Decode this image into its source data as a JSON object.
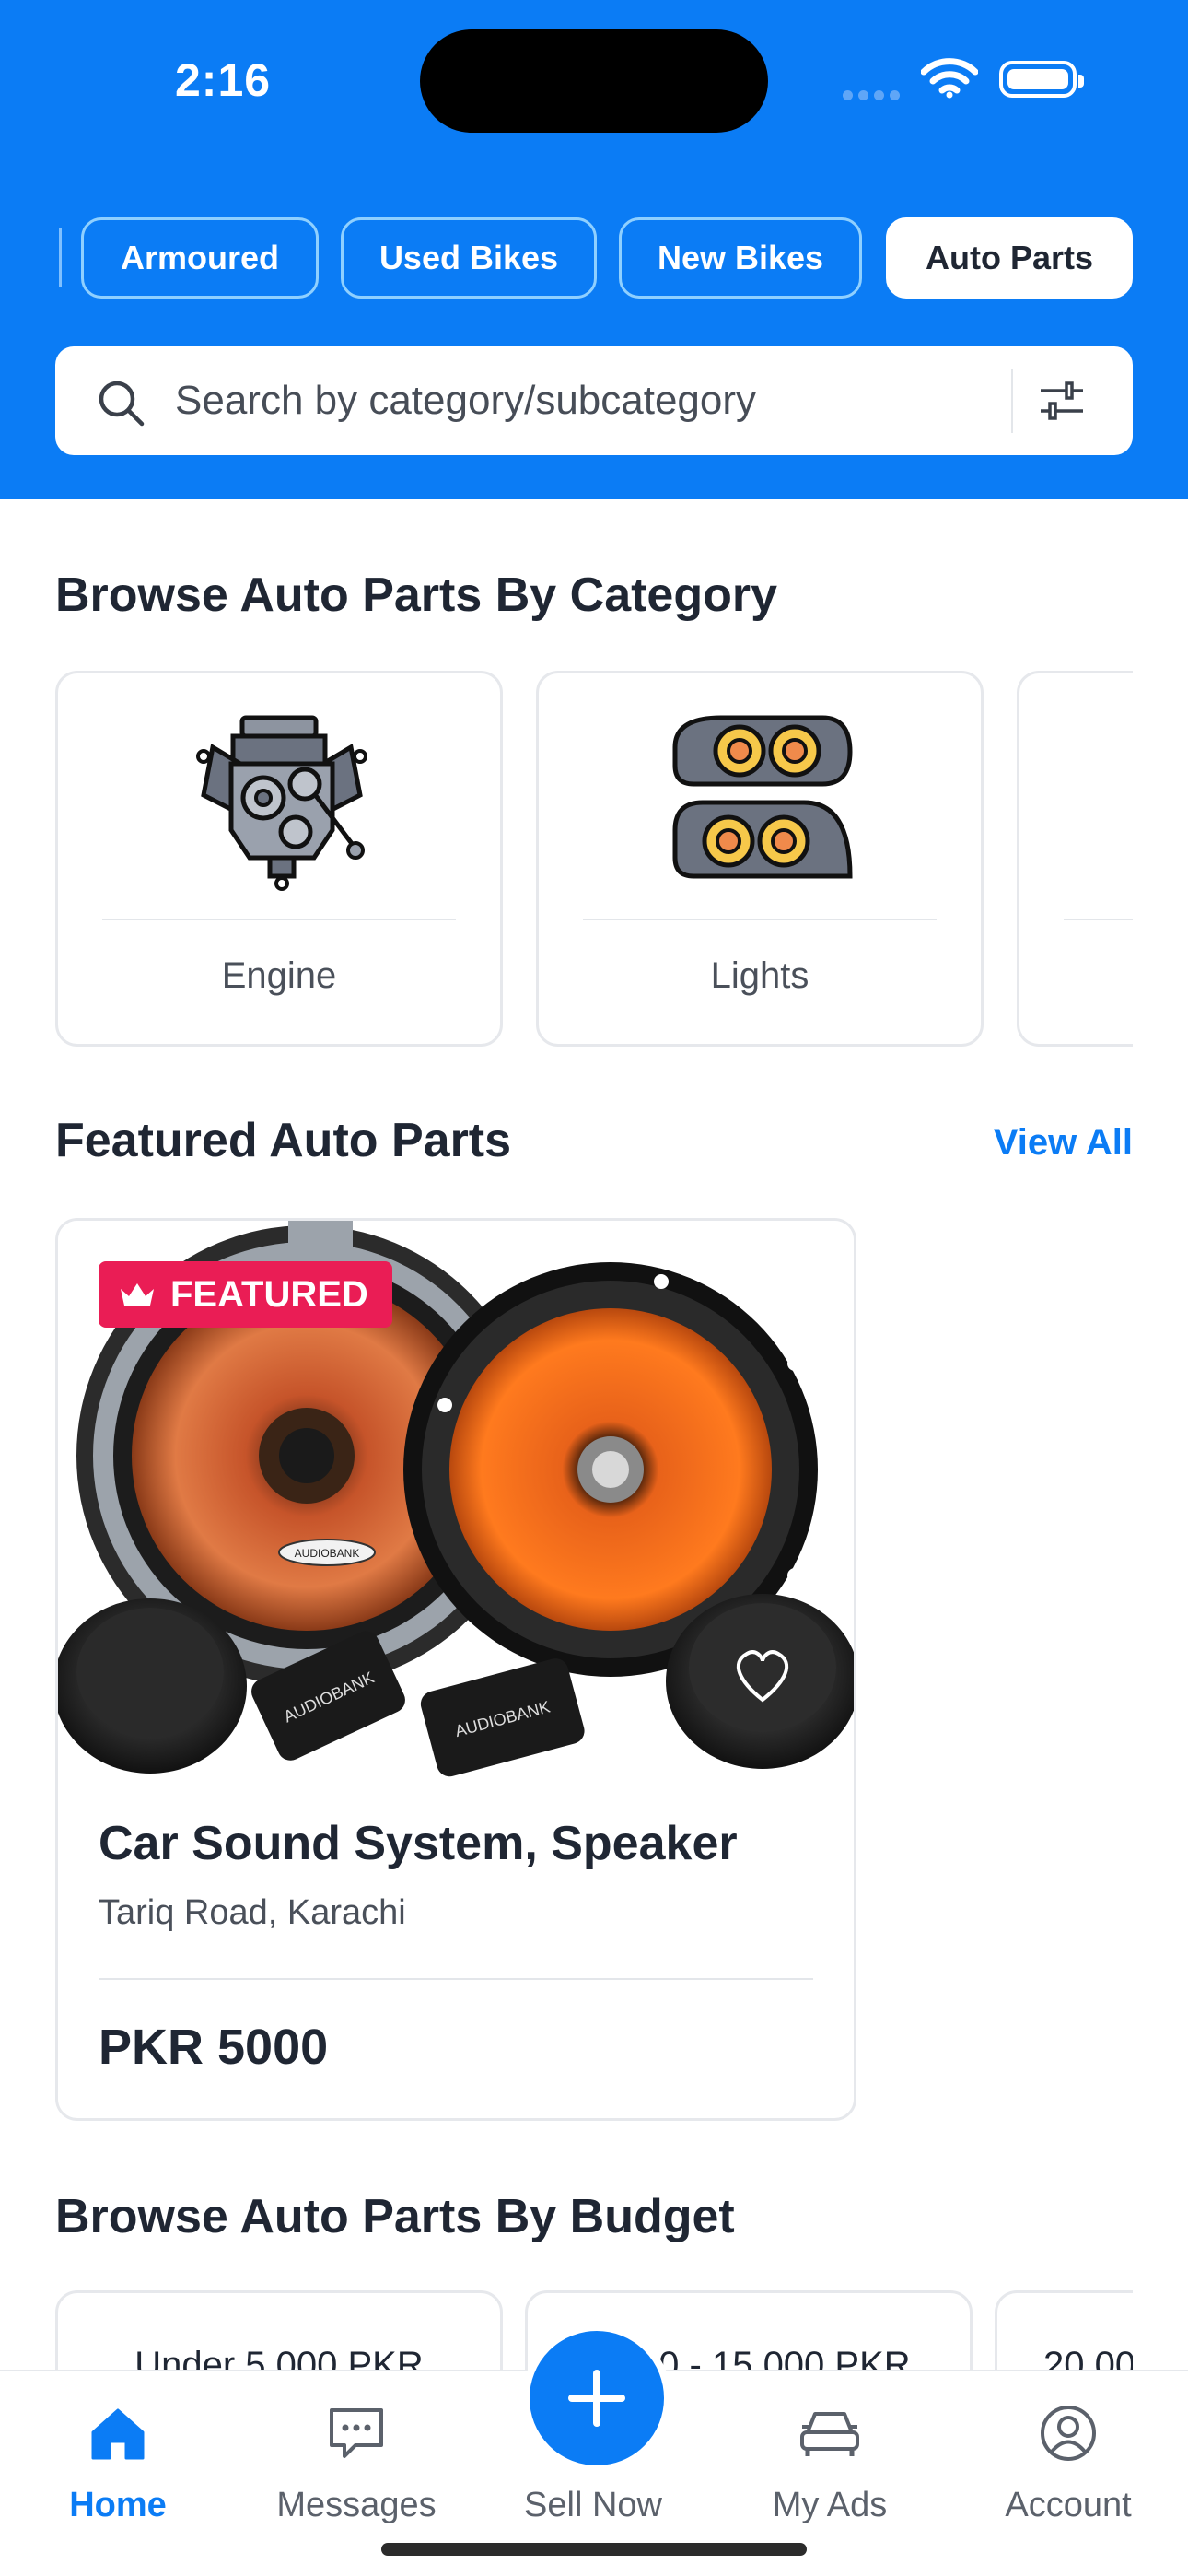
{
  "status_bar": {
    "time": "2:16"
  },
  "category_chips": [
    {
      "label": "Armoured"
    },
    {
      "label": "Used Bikes"
    },
    {
      "label": "New Bikes"
    },
    {
      "label": "Auto Parts",
      "active": true
    }
  ],
  "search": {
    "placeholder": "Search by category/subcategory",
    "search_icon": "search-icon",
    "filter_icon": "sliders-icon"
  },
  "browse_category": {
    "title": "Browse Auto Parts By Category",
    "items": [
      {
        "label": "Engine",
        "icon": "engine-icon"
      },
      {
        "label": "Lights",
        "icon": "headlights-icon"
      },
      {
        "label": "",
        "icon": ""
      }
    ]
  },
  "featured": {
    "title": "Featured Auto Parts",
    "view_all": "View All",
    "product": {
      "badge": "FEATURED",
      "badge_icon": "crown-icon",
      "title": "Car Sound System, Speaker",
      "location": "Tariq Road, Karachi",
      "price": "PKR 5000",
      "image_brand_text": "AUDIOBANK",
      "favorite_icon": "heart-icon"
    }
  },
  "browse_budget": {
    "title": "Browse Auto Parts By Budget",
    "items": [
      {
        "label": "Under 5,000 PKR"
      },
      {
        "label": "5,000 - 15,000 PKR"
      },
      {
        "label": "20,00"
      }
    ]
  },
  "tabbar": {
    "items": [
      {
        "label": "Home",
        "icon": "home-icon",
        "active": true
      },
      {
        "label": "Messages",
        "icon": "message-icon"
      },
      {
        "label": "Sell Now",
        "icon": "plus-icon"
      },
      {
        "label": "My Ads",
        "icon": "car-icon"
      },
      {
        "label": "Account",
        "icon": "user-icon"
      }
    ]
  },
  "colors": {
    "primary": "#0b7cf5",
    "badge": "#ea1d55",
    "text": "#1f2633",
    "muted": "#4a505a",
    "card_border": "#e6e8ec"
  }
}
